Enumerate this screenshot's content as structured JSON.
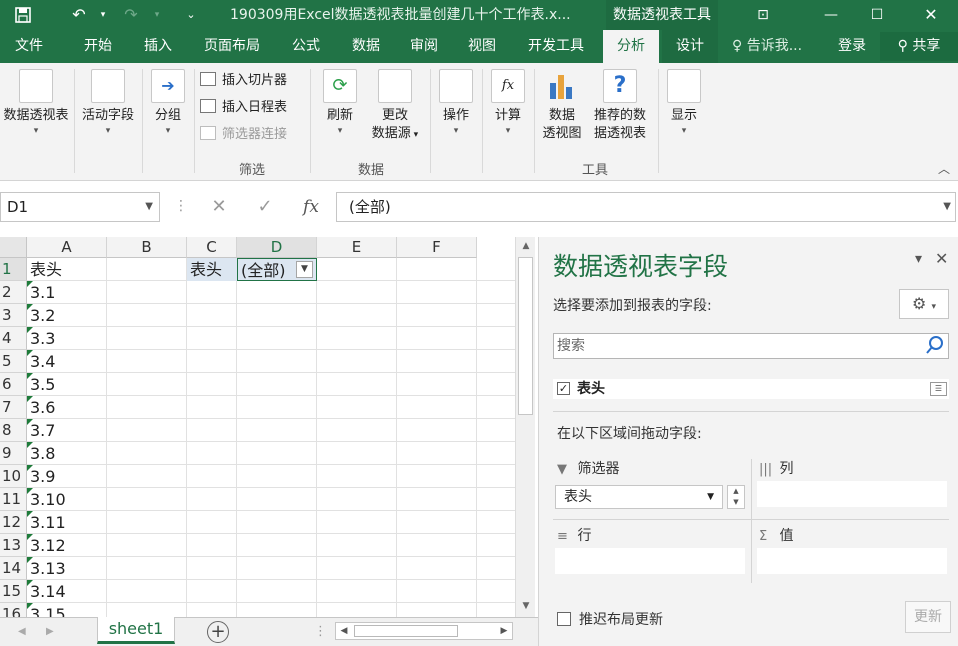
{
  "titlebar": {
    "title": "190309用Excel数据透视表批量创建几十个工作表.x...",
    "tool_title": "数据透视表工具"
  },
  "tabs": [
    "文件",
    "开始",
    "插入",
    "页面布局",
    "公式",
    "数据",
    "审阅",
    "视图",
    "开发工具",
    "分析",
    "设计"
  ],
  "active_tab": "分析",
  "tell_me": "告诉我...",
  "login": "登录",
  "share": "共享",
  "ribbon": {
    "pivot_table": "数据透视表",
    "active_field": "活动字段",
    "group": "分组",
    "insert_slicer": "插入切片器",
    "insert_timeline": "插入日程表",
    "filter_connections": "筛选器连接",
    "filter_group": "筛选",
    "refresh": "刷新",
    "change_source_1": "更改",
    "change_source_2": "数据源",
    "data_group": "数据",
    "actions": "操作",
    "calculations": "计算",
    "pivot_chart_1": "数据",
    "pivot_chart_2": "透视图",
    "recommended_1": "推荐的数",
    "recommended_2": "据透视表",
    "tools_group": "工具",
    "show": "显示"
  },
  "formula_bar": {
    "name_box": "D1",
    "fx": "fx",
    "formula": "(全部)"
  },
  "grid": {
    "columns": [
      "A",
      "B",
      "C",
      "D",
      "E",
      "F"
    ],
    "rows": [
      "1",
      "2",
      "3",
      "4",
      "5",
      "6",
      "7",
      "8",
      "9",
      "10",
      "11",
      "12",
      "13",
      "14",
      "15",
      "16"
    ],
    "col_a": [
      "表头",
      "3.1",
      "3.2",
      "3.3",
      "3.4",
      "3.5",
      "3.6",
      "3.7",
      "3.8",
      "3.9",
      "3.10",
      "3.11",
      "3.12",
      "3.13",
      "3.14",
      "3.15"
    ],
    "c1": "表头",
    "d1": "(全部)"
  },
  "sheets": [
    "sheet1"
  ],
  "pane": {
    "title": "数据透视表字段",
    "subtitle": "选择要添加到报表的字段:",
    "search_placeholder": "搜索",
    "field": "表头",
    "drag_tip": "在以下区域间拖动字段:",
    "filters": "筛选器",
    "columns": "列",
    "rows": "行",
    "values": "值",
    "filter_item": "表头",
    "defer": "推迟布局更新",
    "update": "更新"
  },
  "icons": {
    "save": "save-icon",
    "undo": "undo-icon",
    "redo": "redo-icon",
    "gear": "gear-icon",
    "search": "search-icon"
  },
  "colors": {
    "accent": "#217346",
    "pivot_cell": "#dce6f1"
  }
}
